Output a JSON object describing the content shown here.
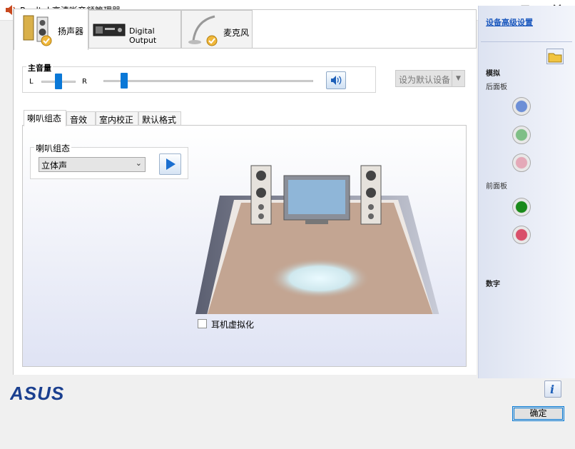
{
  "window": {
    "title": "Realtek高清晰音频管理器",
    "minimize_glyph": "—",
    "maximize_glyph": "☐",
    "close_glyph": "✕"
  },
  "device_tabs": [
    {
      "label": "扬声器",
      "icon": "speaker-icon",
      "active": true
    },
    {
      "label": "Digital Output",
      "icon": "digital-output-icon",
      "active": false
    },
    {
      "label": "麦克风",
      "icon": "microphone-icon",
      "active": false
    }
  ],
  "volume": {
    "legend": "主音量",
    "left_label": "L",
    "right_label": "R",
    "balance_level": 0.5,
    "master_level": 0.1
  },
  "default_device_button": "设为默认设备",
  "inner_tabs": [
    {
      "label": "喇叭组态",
      "active": true
    },
    {
      "label": "音效",
      "active": false
    },
    {
      "label": "室内校正",
      "active": false
    },
    {
      "label": "默认格式",
      "active": false
    }
  ],
  "speaker_config": {
    "legend": "喇叭组态",
    "selected": "立体声"
  },
  "headphone_virtualization": {
    "label": "耳机虚拟化",
    "checked": false
  },
  "right_panel": {
    "advanced_link": "设备高级设置",
    "analog_heading": "模拟",
    "rear_panel": "后面板",
    "front_panel": "前面板",
    "digital_heading": "数字",
    "rear_jacks": [
      "#6d8fd6",
      "#7fbf86",
      "#e4a9b8"
    ],
    "front_jacks": [
      "#1a8a1a",
      "#d9506a"
    ]
  },
  "bottom": {
    "logo_text": "ASUS",
    "ok_label": "确定"
  }
}
